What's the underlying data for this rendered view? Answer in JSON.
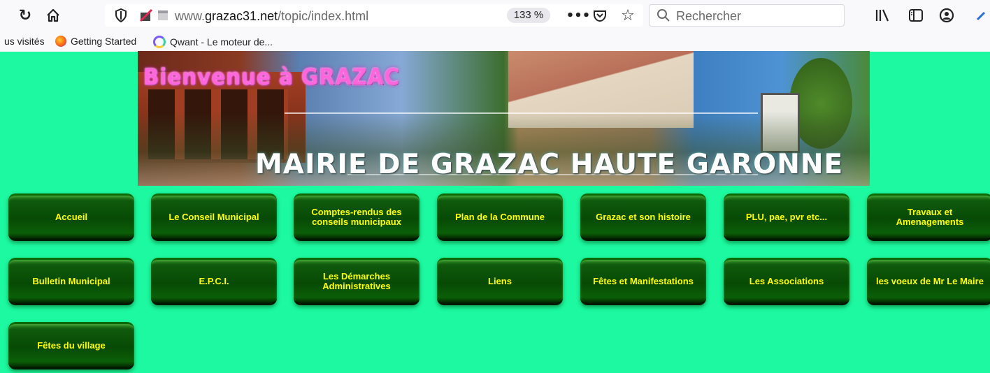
{
  "browser": {
    "url_prefix": "www.",
    "url_domain": "grazac31.net",
    "url_path": "/topic/index.html",
    "zoom": "133 %",
    "search_placeholder": "Rechercher",
    "icons": [
      "reload-icon",
      "home-icon",
      "shield-icon",
      "tracking-icon",
      "page-icon",
      "more-icon",
      "pocket-icon",
      "star-icon",
      "search-icon",
      "library-icon",
      "sidebar-icon",
      "account-icon"
    ]
  },
  "bookmarks": {
    "item1": "us visités",
    "item2": "Getting Started",
    "item3": "Qwant - Le moteur de..."
  },
  "banner": {
    "title": "Bienvenue à GRAZAC",
    "subtitle": "MAIRIE DE GRAZAC HAUTE GARONNE"
  },
  "nav": {
    "accueil": "Accueil",
    "conseil": "Le Conseil Municipal",
    "comptes_rendus": "Comptes-rendus des conseils municipaux",
    "plan": "Plan de la Commune",
    "histoire": "Grazac et son histoire",
    "plu": "PLU, pae, pvr etc...",
    "travaux": "Travaux et Amenagements",
    "bulletin": "Bulletin Municipal",
    "epci": "E.P.C.I.",
    "demarches": "Les Démarches Administratives",
    "liens": "Liens",
    "fetes": "Fêtes et Manifestations",
    "associations": "Les Associations",
    "voeux": "les voeux de Mr Le Maire",
    "fetes_village": "Fêtes du village"
  },
  "colors": {
    "page_background": "#1cf9a0",
    "button_green": "#074a05",
    "button_text": "#ffff00"
  }
}
